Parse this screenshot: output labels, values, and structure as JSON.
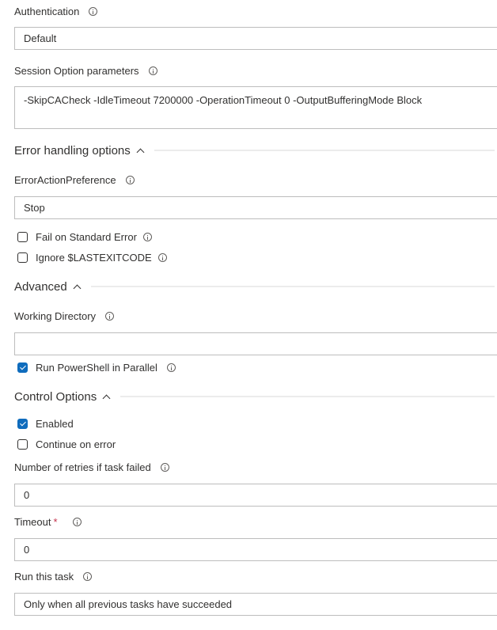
{
  "colors": {
    "accent": "#0f6cbd",
    "required": "#c4314b"
  },
  "authentication": {
    "label": "Authentication",
    "value": "Default"
  },
  "session_options": {
    "label": "Session Option parameters",
    "value": "-SkipCACheck -IdleTimeout 7200000 -OperationTimeout 0 -OutputBufferingMode Block"
  },
  "error_handling": {
    "title": "Error handling options",
    "error_action_preference": {
      "label": "ErrorActionPreference",
      "value": "Stop"
    },
    "fail_on_stderr": {
      "label": "Fail on Standard Error",
      "checked": false
    },
    "ignore_lastexitcode": {
      "label": "Ignore $LASTEXITCODE",
      "checked": false
    }
  },
  "advanced": {
    "title": "Advanced",
    "working_directory": {
      "label": "Working Directory",
      "value": ""
    },
    "run_parallel": {
      "label": "Run PowerShell in Parallel",
      "checked": true
    }
  },
  "control_options": {
    "title": "Control Options",
    "enabled": {
      "label": "Enabled",
      "checked": true
    },
    "continue_on_error": {
      "label": "Continue on error",
      "checked": false
    },
    "retries": {
      "label": "Number of retries if task failed",
      "value": "0"
    },
    "timeout": {
      "label": "Timeout",
      "required_marker": "*",
      "value": "0"
    },
    "run_this_task": {
      "label": "Run this task",
      "value": "Only when all previous tasks have succeeded"
    }
  }
}
